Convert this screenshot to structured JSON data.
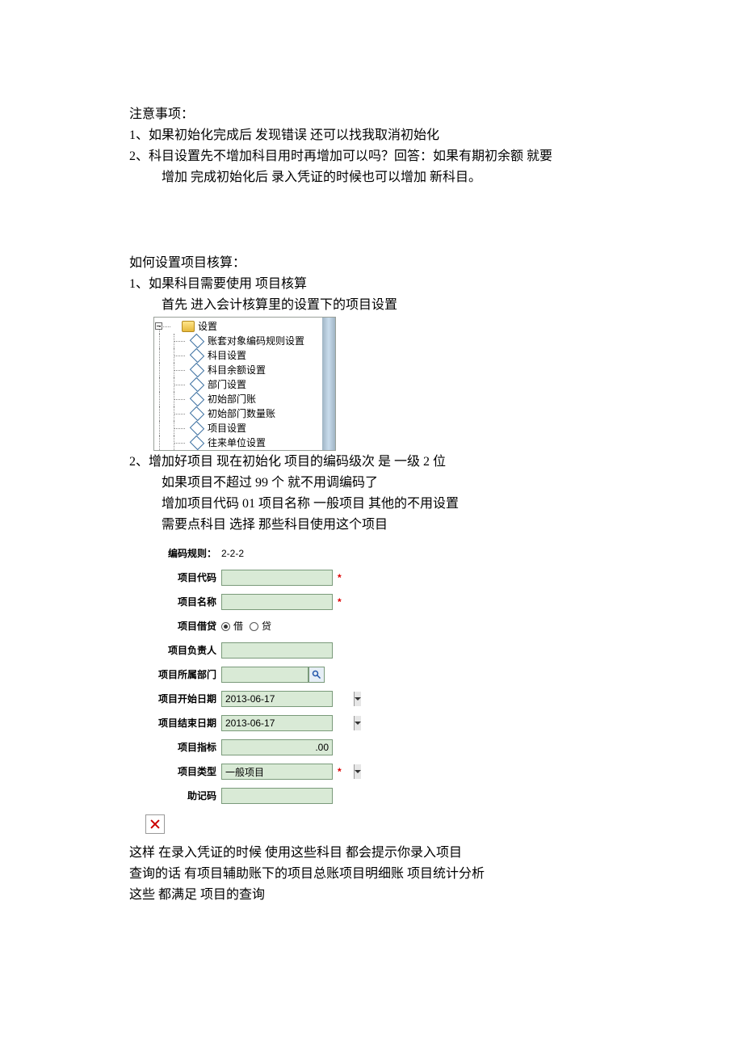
{
  "notes_heading": "注意事项：",
  "note1": "1、如果初始化完成后 发现错误   还可以找我取消初始化",
  "note2_a": "2、科目设置先不增加科目用时再增加可以吗？回答：如果有期初余额 就要",
  "note2_b": "增加     完成初始化后 录入凭证的时候也可以增加 新科目。",
  "howto_heading": "如何设置项目核算：",
  "step1_a": "1、如果科目需要使用      项目核算",
  "step1_b": "首先   进入会计核算里的设置下的项目设置",
  "tree": {
    "root": "设置",
    "items": [
      "账套对象编码规则设置",
      "科目设置",
      "科目余额设置",
      "部门设置",
      "初始部门账",
      "初始部门数量账",
      "项目设置",
      "往来单位设置"
    ]
  },
  "step2_a": "2、增加好项目   现在初始化     项目的编码级次   是   一级 2 位",
  "step2_b": "如果项目不超过 99 个    就不用调编码了",
  "step2_c": "增加项目代码   01            项目名称     一般项目         其他的不用设置",
  "step2_d": "需要点科目   选择    那些科目使用这个项目",
  "form": {
    "rule_lbl": "编码规则：",
    "rule_val": "2-2-2",
    "code_lbl": "项目代码",
    "name_lbl": "项目名称",
    "dc_lbl": "项目借贷",
    "dc_debit": "借",
    "dc_credit": "贷",
    "owner_lbl": "项目负责人",
    "dept_lbl": "项目所属部门",
    "start_lbl": "项目开始日期",
    "start_val": "2013-06-17",
    "end_lbl": "项目结束日期",
    "end_val": "2013-06-17",
    "target_lbl": "项目指标",
    "target_val": ".00",
    "type_lbl": "项目类型",
    "type_val": "一般项目",
    "mnemonic_lbl": "助记码",
    "req": "*"
  },
  "tail1": "这样   在录入凭证的时候   使用这些科目   都会提示你录入项目",
  "tail2": "查询的话   有项目辅助账下的项目总账项目明细账 项目统计分析",
  "tail3": "这些   都满足   项目的查询"
}
